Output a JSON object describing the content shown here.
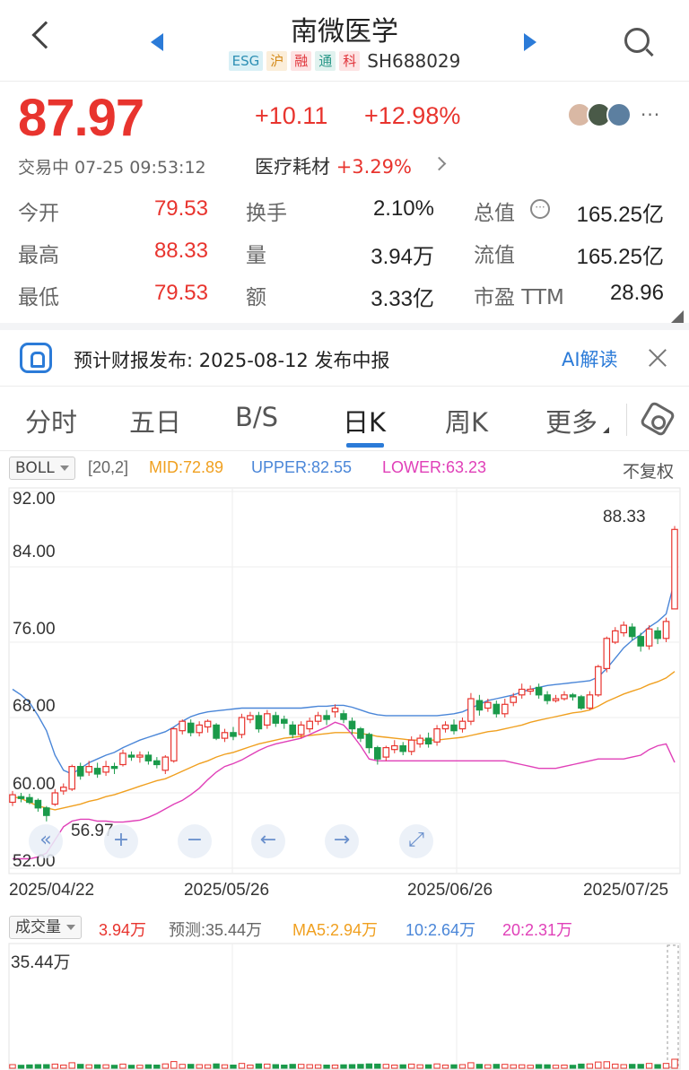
{
  "header": {
    "title": "南微医学",
    "tags": [
      "ESG",
      "沪",
      "融",
      "通",
      "科"
    ],
    "code": "SH688029"
  },
  "quote": {
    "price": "87.97",
    "change": "+10.11",
    "change_pct": "+12.98%",
    "status": "交易中 07-25 09:53:12",
    "sector": "医疗耗材",
    "sector_change": "+3.29%",
    "more": "···"
  },
  "stats": [
    {
      "label": "今开",
      "value": "79.53",
      "color": "red"
    },
    {
      "label": "换手",
      "value": "2.10%",
      "color": "black"
    },
    {
      "label": "总值",
      "value": "165.25亿",
      "color": "black"
    },
    {
      "label": "最高",
      "value": "88.33",
      "color": "red"
    },
    {
      "label": "量",
      "value": "3.94万",
      "color": "black"
    },
    {
      "label": "流值",
      "value": "165.25亿",
      "color": "black"
    },
    {
      "label": "最低",
      "value": "79.53",
      "color": "red"
    },
    {
      "label": "额",
      "value": "3.33亿",
      "color": "black"
    },
    {
      "label": "市盈 TTM",
      "value": "28.96",
      "color": "black"
    }
  ],
  "banner": {
    "text": "预计财报发布: 2025-08-12 发布中报",
    "link": "AI解读"
  },
  "tabs": [
    "分时",
    "五日",
    "B/S",
    "日K",
    "周K",
    "更多"
  ],
  "active_tab": "日K",
  "boll": {
    "indicator": "BOLL",
    "params": "[20,2]",
    "mid": "MID:72.89",
    "upper": "UPPER:82.55",
    "lower": "LOWER:63.23",
    "adjust": "不复权"
  },
  "colors": {
    "up": "#e8342e",
    "down": "#1a9a4a",
    "mid": "#f0a020",
    "upper": "#4a86d8",
    "lower": "#e040b8",
    "accent": "#2b7bd8"
  },
  "chart_data": [
    {
      "type": "candlestick",
      "y_ticks": [
        "92.00",
        "84.00",
        "76.00",
        "68.00",
        "60.00",
        "52.00"
      ],
      "ylim": [
        52,
        92
      ],
      "x_labels": [
        "2025/04/22",
        "2025/05/26",
        "2025/06/26",
        "2025/07/25"
      ],
      "high_label": "88.33",
      "low_label": "56.97",
      "candles": [
        [
          59.0,
          59.8,
          58.6,
          60.2
        ],
        [
          59.6,
          59.4,
          59.0,
          60.0
        ],
        [
          59.5,
          59.0,
          58.8,
          59.9
        ],
        [
          59.2,
          58.4,
          58.0,
          59.4
        ],
        [
          58.4,
          57.6,
          56.97,
          58.6
        ],
        [
          58.8,
          60.0,
          58.6,
          60.4
        ],
        [
          60.2,
          60.6,
          59.8,
          61.0
        ],
        [
          60.4,
          62.8,
          60.2,
          63.0
        ],
        [
          62.8,
          61.8,
          61.4,
          63.2
        ],
        [
          62.2,
          62.8,
          61.8,
          63.4
        ],
        [
          62.6,
          62.0,
          61.6,
          63.2
        ],
        [
          62.2,
          62.8,
          61.8,
          63.4
        ],
        [
          62.8,
          62.6,
          62.0,
          63.2
        ],
        [
          63.0,
          64.2,
          62.8,
          64.6
        ],
        [
          64.0,
          63.8,
          63.4,
          64.4
        ],
        [
          63.8,
          64.0,
          63.2,
          64.4
        ],
        [
          64.0,
          63.4,
          63.0,
          64.4
        ],
        [
          63.4,
          63.0,
          62.6,
          63.8
        ],
        [
          62.4,
          63.8,
          62.0,
          64.0
        ],
        [
          63.4,
          66.8,
          63.2,
          67.0
        ],
        [
          66.6,
          67.6,
          66.2,
          67.8
        ],
        [
          67.4,
          66.4,
          66.0,
          67.8
        ],
        [
          66.4,
          67.2,
          66.0,
          67.6
        ],
        [
          67.0,
          67.6,
          66.4,
          67.8
        ],
        [
          67.2,
          65.8,
          65.6,
          67.4
        ],
        [
          65.8,
          66.4,
          65.4,
          66.8
        ],
        [
          66.4,
          66.0,
          65.6,
          67.0
        ],
        [
          66.2,
          68.0,
          65.8,
          68.4
        ],
        [
          67.8,
          68.2,
          67.4,
          68.6
        ],
        [
          68.2,
          66.8,
          66.4,
          68.6
        ],
        [
          67.2,
          68.4,
          66.8,
          68.8
        ],
        [
          68.2,
          67.4,
          67.0,
          68.6
        ],
        [
          67.8,
          67.4,
          66.8,
          68.2
        ],
        [
          67.2,
          66.2,
          65.8,
          67.6
        ],
        [
          66.2,
          67.2,
          65.8,
          67.6
        ],
        [
          66.8,
          67.6,
          66.4,
          68.0
        ],
        [
          67.6,
          68.2,
          67.2,
          68.6
        ],
        [
          68.2,
          67.8,
          67.2,
          68.8
        ],
        [
          68.6,
          69.0,
          68.0,
          69.4
        ],
        [
          68.4,
          67.8,
          67.4,
          68.8
        ],
        [
          67.6,
          66.8,
          66.2,
          68.0
        ],
        [
          66.8,
          65.8,
          65.4,
          67.0
        ],
        [
          66.2,
          64.8,
          64.2,
          66.4
        ],
        [
          64.8,
          63.6,
          63.0,
          65.0
        ],
        [
          63.8,
          64.8,
          63.4,
          65.0
        ],
        [
          64.6,
          65.0,
          64.2,
          65.6
        ],
        [
          65.0,
          64.4,
          64.0,
          65.4
        ],
        [
          64.4,
          65.6,
          64.0,
          66.0
        ],
        [
          65.2,
          65.8,
          64.8,
          66.2
        ],
        [
          65.8,
          65.2,
          64.8,
          66.4
        ],
        [
          65.4,
          66.8,
          65.0,
          67.2
        ],
        [
          66.8,
          67.2,
          66.4,
          67.6
        ],
        [
          67.2,
          66.6,
          66.2,
          67.8
        ],
        [
          66.8,
          67.6,
          66.4,
          68.0
        ],
        [
          67.6,
          70.0,
          67.2,
          70.6
        ],
        [
          69.8,
          68.8,
          68.2,
          70.4
        ],
        [
          69.0,
          69.6,
          68.6,
          70.0
        ],
        [
          69.4,
          68.4,
          68.0,
          69.8
        ],
        [
          68.4,
          69.4,
          68.0,
          70.0
        ],
        [
          69.6,
          70.2,
          69.2,
          70.6
        ],
        [
          70.4,
          71.0,
          70.0,
          71.6
        ],
        [
          70.8,
          71.0,
          70.4,
          71.4
        ],
        [
          71.2,
          70.4,
          70.0,
          71.6
        ],
        [
          70.4,
          69.8,
          69.4,
          70.8
        ],
        [
          69.8,
          70.0,
          69.6,
          70.4
        ],
        [
          70.0,
          70.4,
          69.8,
          70.8
        ],
        [
          70.4,
          70.2,
          69.8,
          70.6
        ],
        [
          70.2,
          69.0,
          68.8,
          70.4
        ],
        [
          69.0,
          70.4,
          68.8,
          70.8
        ],
        [
          70.4,
          73.4,
          70.2,
          73.6
        ],
        [
          73.2,
          76.4,
          72.8,
          76.6
        ],
        [
          76.0,
          77.2,
          75.8,
          77.6
        ],
        [
          77.0,
          77.8,
          76.6,
          78.2
        ],
        [
          77.6,
          76.6,
          76.2,
          78.0
        ],
        [
          76.6,
          75.6,
          75.0,
          77.0
        ],
        [
          75.6,
          77.4,
          75.2,
          77.8
        ],
        [
          77.2,
          76.4,
          75.8,
          77.6
        ],
        [
          76.4,
          78.2,
          76.0,
          78.6
        ],
        [
          79.53,
          87.97,
          79.53,
          88.33
        ]
      ],
      "mid_band": [
        59.6,
        59.4,
        59.0,
        58.6,
        58.4,
        58.2,
        58.4,
        58.6,
        58.8,
        59.1,
        59.3,
        59.6,
        59.8,
        60.1,
        60.4,
        60.7,
        61.0,
        61.3,
        61.5,
        61.9,
        62.3,
        62.7,
        63.1,
        63.4,
        63.8,
        64.1,
        64.3,
        64.6,
        64.9,
        65.2,
        65.4,
        65.6,
        65.8,
        65.9,
        66.0,
        66.1,
        66.2,
        66.3,
        66.4,
        66.4,
        66.4,
        66.3,
        66.2,
        66.0,
        65.9,
        65.8,
        65.7,
        65.6,
        65.6,
        65.6,
        65.6,
        65.7,
        65.8,
        65.9,
        66.1,
        66.3,
        66.5,
        66.6,
        66.8,
        67.0,
        67.2,
        67.5,
        67.7,
        67.9,
        68.1,
        68.3,
        68.5,
        68.6,
        68.8,
        69.2,
        69.7,
        70.1,
        70.5,
        70.8,
        71.1,
        71.5,
        71.8,
        72.2,
        72.89
      ],
      "upper_band": [
        71.0,
        70.4,
        69.6,
        68.2,
        66.6,
        64.0,
        62.4,
        62.0,
        62.6,
        63.2,
        63.6,
        64.0,
        64.3,
        64.8,
        65.2,
        65.6,
        65.9,
        66.2,
        66.5,
        67.0,
        67.6,
        68.1,
        68.4,
        68.6,
        68.7,
        68.8,
        68.9,
        69.0,
        69.0,
        69.0,
        69.0,
        69.0,
        69.0,
        69.0,
        69.0,
        69.1,
        69.2,
        69.2,
        69.3,
        69.3,
        69.1,
        68.8,
        68.5,
        68.3,
        68.2,
        68.2,
        68.2,
        68.2,
        68.2,
        68.2,
        68.2,
        68.3,
        68.4,
        68.6,
        69.0,
        69.4,
        69.8,
        70.0,
        70.2,
        70.4,
        70.7,
        71.0,
        71.2,
        71.4,
        71.5,
        71.6,
        71.7,
        71.8,
        71.9,
        72.3,
        73.2,
        74.3,
        75.4,
        76.2,
        76.8,
        77.6,
        78.2,
        79.0,
        82.55
      ],
      "lower_band": [
        53.0,
        53.0,
        53.0,
        53.2,
        53.6,
        55.0,
        56.4,
        57.0,
        57.2,
        57.2,
        57.0,
        57.0,
        56.9,
        56.9,
        57.0,
        57.1,
        57.4,
        57.8,
        58.3,
        58.8,
        59.2,
        59.8,
        60.5,
        61.4,
        62.2,
        62.8,
        63.1,
        63.5,
        64.0,
        64.5,
        64.9,
        65.2,
        65.4,
        65.6,
        65.8,
        66.2,
        66.6,
        67.0,
        67.5,
        67.2,
        66.2,
        65.0,
        63.6,
        63.4,
        63.4,
        63.4,
        63.4,
        63.4,
        63.4,
        63.4,
        63.4,
        63.4,
        63.4,
        63.4,
        63.4,
        63.4,
        63.4,
        63.4,
        63.4,
        63.2,
        63.0,
        62.8,
        62.6,
        62.6,
        62.6,
        62.8,
        63.0,
        63.2,
        63.4,
        63.6,
        63.6,
        63.6,
        63.6,
        63.8,
        64.0,
        64.6,
        65.0,
        65.2,
        63.23
      ]
    },
    {
      "type": "bar",
      "title": "成交量",
      "y_tick": "35.44万",
      "latest": "3.94万",
      "forecast": "预测:35.44万",
      "ma5": "MA5:2.94万",
      "ma10": "10:2.64万",
      "ma20": "20:2.31万"
    }
  ]
}
